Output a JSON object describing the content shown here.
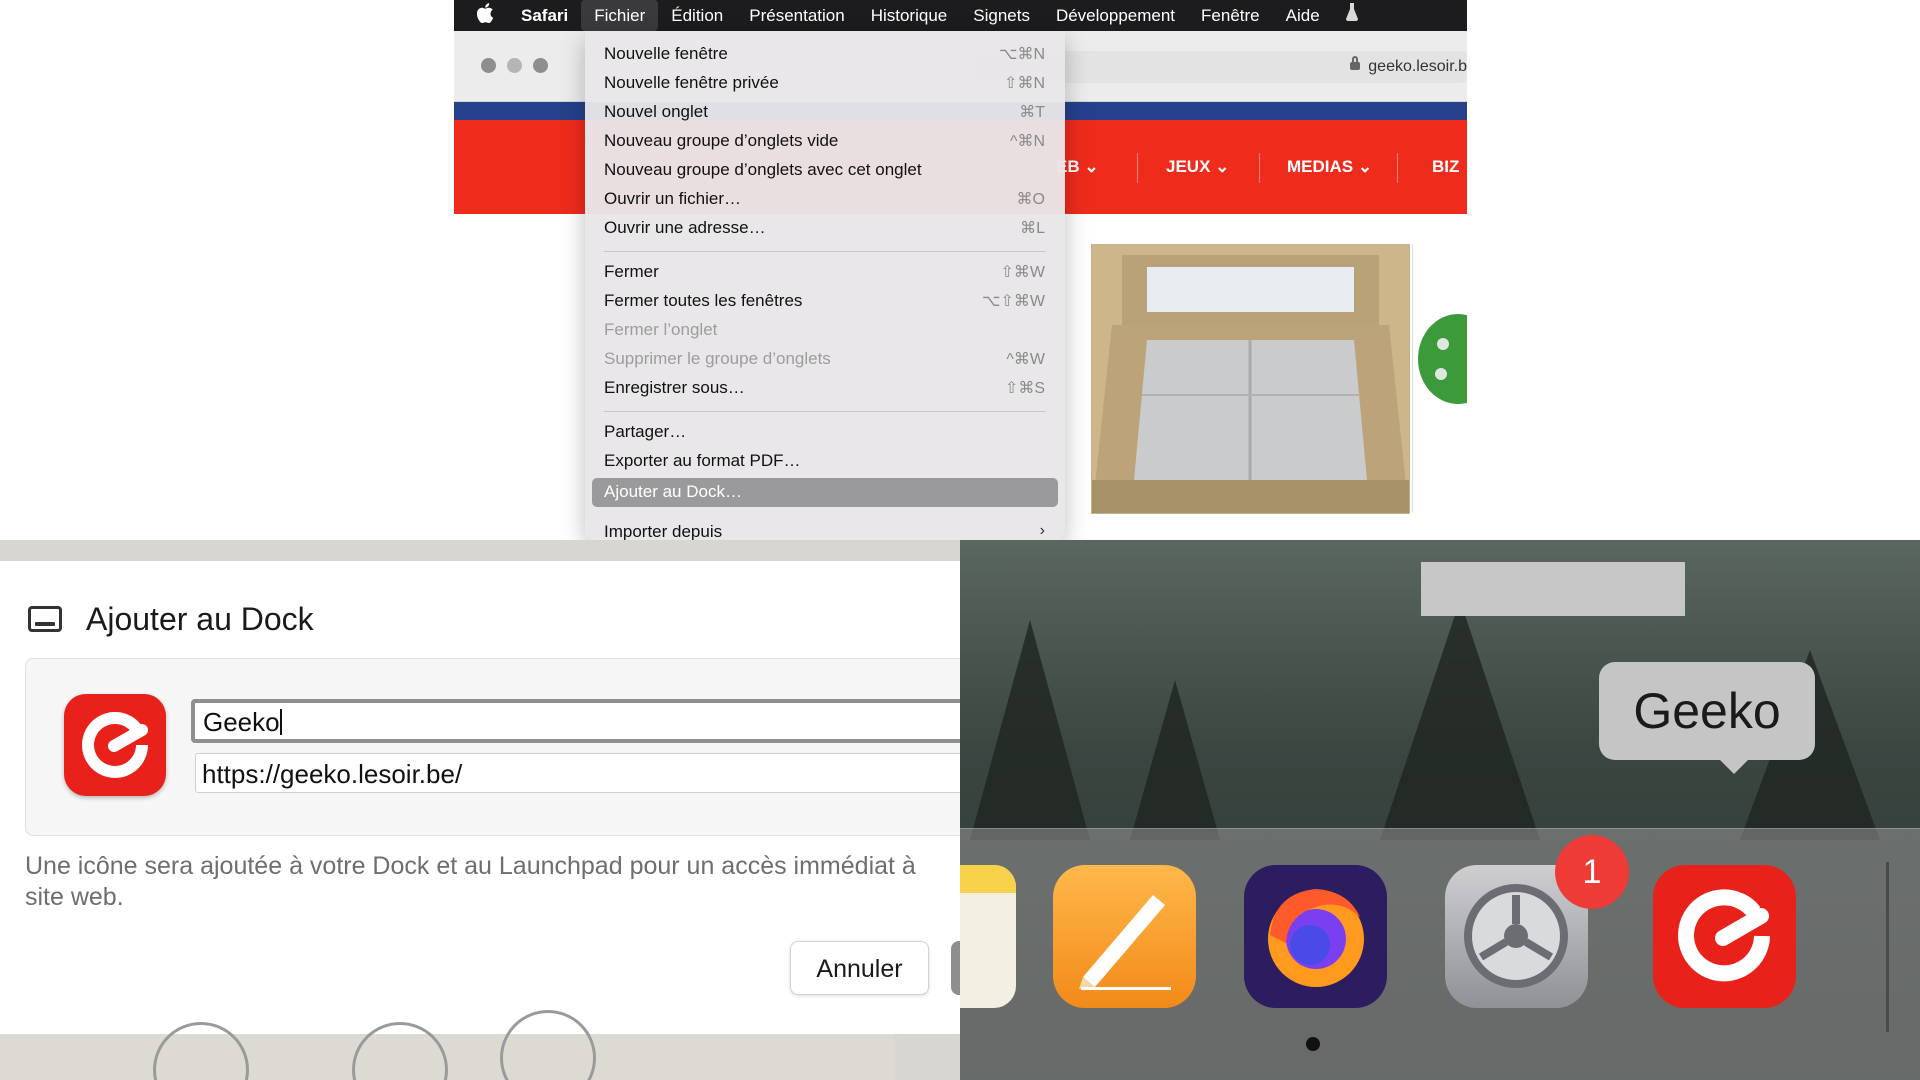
{
  "menubar": {
    "apple_symbol": "",
    "items": [
      "Safari",
      "Fichier",
      "Édition",
      "Présentation",
      "Historique",
      "Signets",
      "Développement",
      "Fenêtre",
      "Aide"
    ]
  },
  "browser": {
    "url": "geeko.lesoir.b",
    "nav": [
      "EB",
      "JEUX",
      "MEDIAS",
      "BIZ"
    ]
  },
  "file_menu": {
    "items": [
      {
        "label": "Nouvelle fenêtre",
        "shortcut": "⌥⌘N"
      },
      {
        "label": "Nouvelle fenêtre privée",
        "shortcut": "⇧⌘N"
      },
      {
        "label": "Nouvel onglet",
        "shortcut": "⌘T"
      },
      {
        "label": "Nouveau groupe d’onglets vide",
        "shortcut": "^⌘N"
      },
      {
        "label": "Nouveau groupe d’onglets avec cet onglet",
        "shortcut": ""
      },
      {
        "label": "Ouvrir un fichier…",
        "shortcut": "⌘O"
      },
      {
        "label": "Ouvrir une adresse…",
        "shortcut": "⌘L"
      },
      {
        "label": "Fermer",
        "shortcut": "⇧⌘W"
      },
      {
        "label": "Fermer toutes les fenêtres",
        "shortcut": "⌥⇧⌘W"
      },
      {
        "label": "Fermer l’onglet",
        "shortcut": ""
      },
      {
        "label": "Supprimer le groupe d’onglets",
        "shortcut": "^⌘W"
      },
      {
        "label": "Enregistrer sous…",
        "shortcut": "⇧⌘S"
      },
      {
        "label": "Partager…",
        "shortcut": ""
      },
      {
        "label": "Exporter au format PDF…",
        "shortcut": ""
      },
      {
        "label": "Ajouter au Dock…",
        "shortcut": ""
      },
      {
        "label": "Importer depuis",
        "shortcut": "›"
      }
    ]
  },
  "dialog": {
    "title": "Ajouter au Dock",
    "name_value": "Geeko",
    "url_value": "https://geeko.lesoir.be/",
    "description": "Une icône sera ajoutée à votre Dock et au Launchpad pour un accès immédiat à site web.",
    "cancel_label": "Annuler"
  },
  "dock": {
    "tooltip": "Geeko",
    "badge": "1",
    "apps": [
      "notes-icon",
      "pages-icon",
      "firefox-icon",
      "system-preferences-icon",
      "geeko-icon"
    ]
  }
}
